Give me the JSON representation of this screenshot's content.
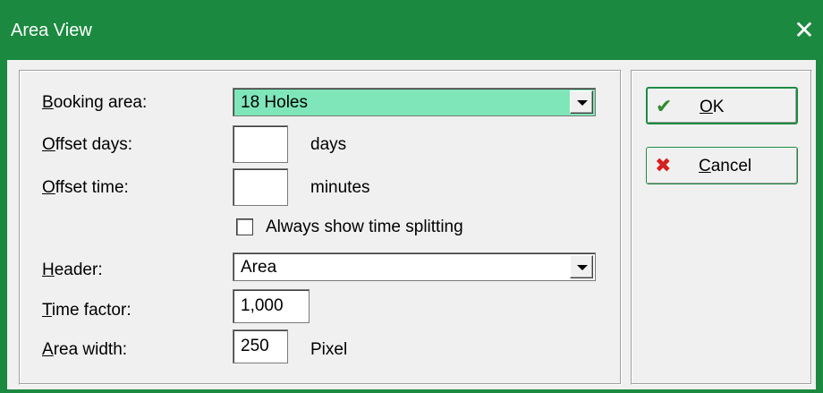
{
  "window": {
    "title": "Area View",
    "close_glyph": "✕"
  },
  "form": {
    "booking_area": {
      "label_ul": "B",
      "label_rest": "ooking area:",
      "value": "18 Holes"
    },
    "offset_days": {
      "label_ul": "O",
      "label_rest": "ffset days:",
      "value": "",
      "unit": "days"
    },
    "offset_time": {
      "label_ul": "O",
      "label_rest": "ffset time:",
      "value": "",
      "unit": "minutes"
    },
    "always_show": {
      "label": "Always show time splitting",
      "checked": false
    },
    "header": {
      "label_ul": "H",
      "label_rest": "eader:",
      "value": "Area"
    },
    "time_factor": {
      "label_ul": "T",
      "label_rest": "ime factor:",
      "value": "1,000"
    },
    "area_width": {
      "label_ul": "A",
      "label_rest": "rea width:",
      "value": "250",
      "unit": "Pixel"
    }
  },
  "buttons": {
    "ok": {
      "ul": "O",
      "rest": "K",
      "icon": "checkmark-icon",
      "glyph": "✔"
    },
    "cancel": {
      "ul": "C",
      "rest": "ancel",
      "icon": "x-icon",
      "glyph": "✖"
    }
  },
  "colors": {
    "titlebar": "#1b8a40",
    "highlight": "#7fe6b9"
  }
}
